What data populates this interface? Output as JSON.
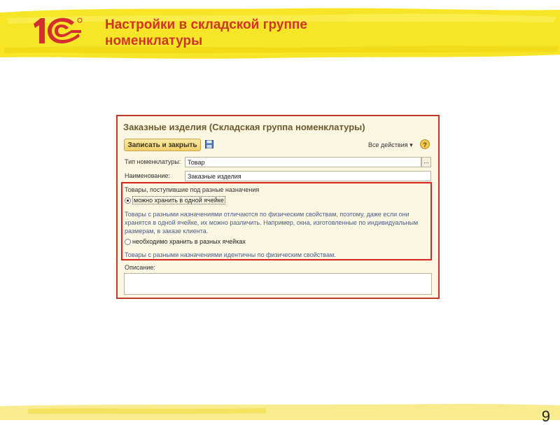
{
  "slide": {
    "title_line1": "Настройки в складской группе",
    "title_line2": "номенклатуры",
    "page_number": "9",
    "logo_icon": "1c-logo-icon"
  },
  "colors": {
    "title": "#d0332a",
    "highlight": "#d9241f",
    "band": "#f7e627"
  },
  "dialog": {
    "title": "Заказные изделия (Складская группа номенклатуры)",
    "toolbar": {
      "save_close_label": "Записать и закрыть",
      "save_icon": "save-icon",
      "all_actions_label": "Все действия ▾",
      "help_label": "?"
    },
    "fields": {
      "type_label": "Тип номенклатуры:",
      "type_value": "Товар",
      "select_button": "...",
      "name_label": "Наименование:",
      "name_value": "Заказные изделия"
    },
    "storage_group": {
      "title": "Товары, поступившие под разные назначения",
      "option1_label": "можно хранить в одной ячейке",
      "option1_selected": true,
      "option1_hint_line1": "Товары с разными назначениями отличаются по физическим свойствам, поэтому, даже если они",
      "option1_hint_line2": "хранятся в одной ячейке, их можно различить. Например, окна, изготовленные по индивидуальным",
      "option1_hint_line3": "размерам, в заказе клиента.",
      "option2_label": "необходимо хранить в разных ячейках",
      "option2_selected": false,
      "option2_hint": "Товары с разными назначениями идентичны по физическим свойствам."
    },
    "description": {
      "label": "Описание:",
      "value": ""
    }
  }
}
